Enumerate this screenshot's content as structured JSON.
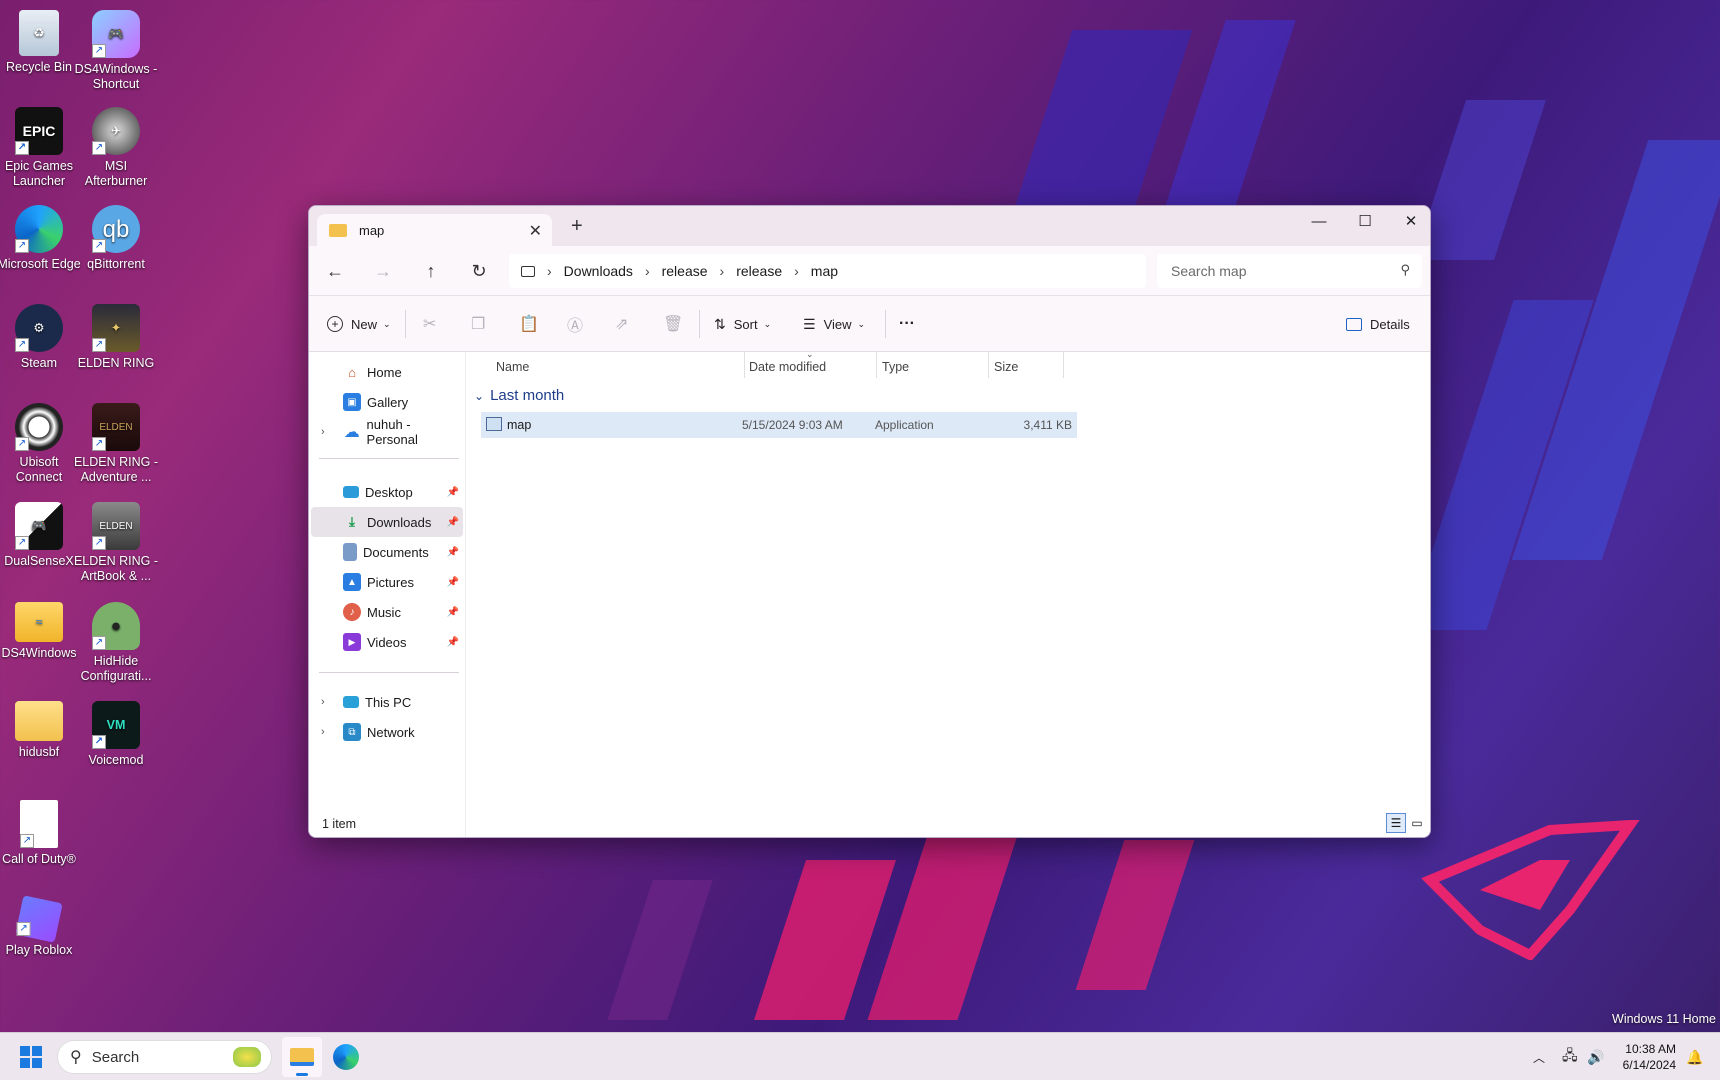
{
  "desktop": {
    "icons": [
      {
        "label": "Recycle Bin"
      },
      {
        "label": "DS4Windows - Shortcut"
      },
      {
        "label": "Epic Games Launcher"
      },
      {
        "label": "MSI Afterburner"
      },
      {
        "label": "Microsoft Edge"
      },
      {
        "label": "qBittorrent"
      },
      {
        "label": "Steam"
      },
      {
        "label": "ELDEN RING"
      },
      {
        "label": "Ubisoft Connect"
      },
      {
        "label": "ELDEN RING - Adventure ..."
      },
      {
        "label": "DualSenseX"
      },
      {
        "label": "ELDEN RING - ArtBook & ..."
      },
      {
        "label": "DS4Windows"
      },
      {
        "label": "HidHide Configurati..."
      },
      {
        "label": "hidusbf"
      },
      {
        "label": "Voicemod"
      },
      {
        "label": "Call of Duty®"
      },
      {
        "label": "Play Roblox"
      }
    ],
    "edition": "Windows 11 Home"
  },
  "window": {
    "tab_title": "map",
    "breadcrumb": [
      "Downloads",
      "release",
      "release",
      "map"
    ],
    "search_placeholder": "Search map",
    "toolbar": {
      "new_label": "New",
      "sort_label": "Sort",
      "view_label": "View",
      "more_label": "···",
      "details_label": "Details"
    },
    "nav": {
      "home": "Home",
      "gallery": "Gallery",
      "onedrive": "nuhuh - Personal",
      "pinned": [
        "Desktop",
        "Downloads",
        "Documents",
        "Pictures",
        "Music",
        "Videos"
      ],
      "this_pc": "This PC",
      "network": "Network"
    },
    "columns": [
      "Name",
      "Date modified",
      "Type",
      "Size"
    ],
    "group_label": "Last month",
    "files": [
      {
        "name": "map",
        "date": "5/15/2024 9:03 AM",
        "type": "Application",
        "size": "3,411 KB"
      }
    ],
    "status": "1 item"
  },
  "taskbar": {
    "search_label": "Search",
    "time": "10:38 AM",
    "date": "6/14/2024"
  }
}
